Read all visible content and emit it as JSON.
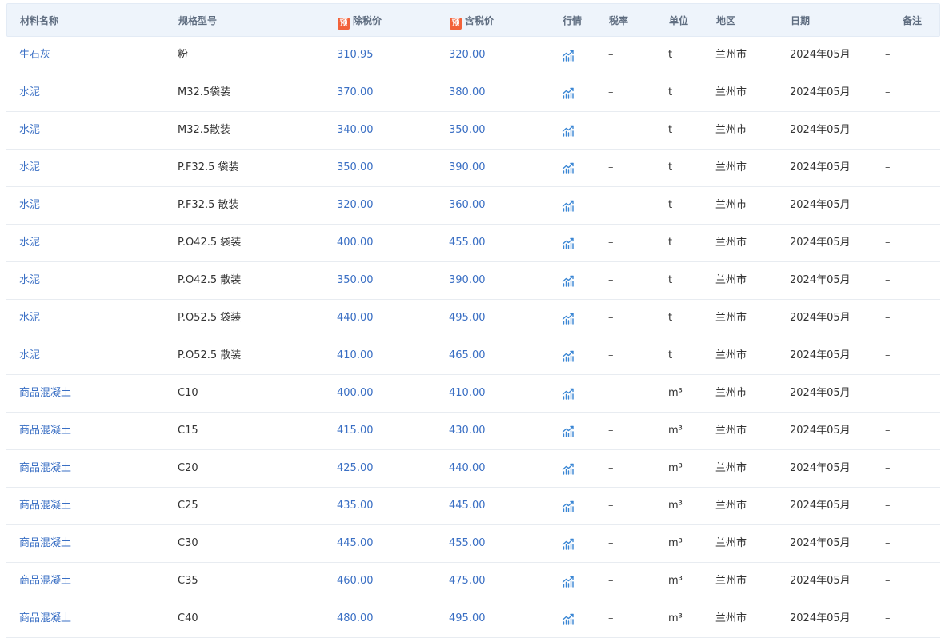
{
  "header": {
    "name": "材料名称",
    "spec": "规格型号",
    "yu_badge": "预",
    "price_ex_tax": "除税价",
    "price_in_tax": "含税价",
    "trend": "行情",
    "tax_rate": "税率",
    "unit": "单位",
    "region": "地区",
    "date": "日期",
    "note": "备注"
  },
  "icons": {
    "trend": "trend-chart-icon"
  },
  "colors": {
    "link": "#3a6fc4",
    "badge": "#f2623a",
    "header_bg": "#eef4fb"
  },
  "rows": [
    {
      "name": "生石灰",
      "spec": "粉",
      "ex": "310.95",
      "inc": "320.00",
      "tax": "–",
      "unit": "t",
      "region": "兰州市",
      "date": "2024年05月",
      "note": "–"
    },
    {
      "name": "水泥",
      "spec": "M32.5袋装",
      "ex": "370.00",
      "inc": "380.00",
      "tax": "–",
      "unit": "t",
      "region": "兰州市",
      "date": "2024年05月",
      "note": "–"
    },
    {
      "name": "水泥",
      "spec": "M32.5散装",
      "ex": "340.00",
      "inc": "350.00",
      "tax": "–",
      "unit": "t",
      "region": "兰州市",
      "date": "2024年05月",
      "note": "–"
    },
    {
      "name": "水泥",
      "spec": "P.F32.5 袋装",
      "ex": "350.00",
      "inc": "390.00",
      "tax": "–",
      "unit": "t",
      "region": "兰州市",
      "date": "2024年05月",
      "note": "–"
    },
    {
      "name": "水泥",
      "spec": "P.F32.5 散装",
      "ex": "320.00",
      "inc": "360.00",
      "tax": "–",
      "unit": "t",
      "region": "兰州市",
      "date": "2024年05月",
      "note": "–"
    },
    {
      "name": "水泥",
      "spec": "P.O42.5 袋装",
      "ex": "400.00",
      "inc": "455.00",
      "tax": "–",
      "unit": "t",
      "region": "兰州市",
      "date": "2024年05月",
      "note": "–"
    },
    {
      "name": "水泥",
      "spec": "P.O42.5 散装",
      "ex": "350.00",
      "inc": "390.00",
      "tax": "–",
      "unit": "t",
      "region": "兰州市",
      "date": "2024年05月",
      "note": "–"
    },
    {
      "name": "水泥",
      "spec": "P.O52.5 袋装",
      "ex": "440.00",
      "inc": "495.00",
      "tax": "–",
      "unit": "t",
      "region": "兰州市",
      "date": "2024年05月",
      "note": "–"
    },
    {
      "name": "水泥",
      "spec": "P.O52.5 散装",
      "ex": "410.00",
      "inc": "465.00",
      "tax": "–",
      "unit": "t",
      "region": "兰州市",
      "date": "2024年05月",
      "note": "–"
    },
    {
      "name": "商品混凝土",
      "spec": "C10",
      "ex": "400.00",
      "inc": "410.00",
      "tax": "–",
      "unit": "m³",
      "region": "兰州市",
      "date": "2024年05月",
      "note": "–"
    },
    {
      "name": "商品混凝土",
      "spec": "C15",
      "ex": "415.00",
      "inc": "430.00",
      "tax": "–",
      "unit": "m³",
      "region": "兰州市",
      "date": "2024年05月",
      "note": "–"
    },
    {
      "name": "商品混凝土",
      "spec": "C20",
      "ex": "425.00",
      "inc": "440.00",
      "tax": "–",
      "unit": "m³",
      "region": "兰州市",
      "date": "2024年05月",
      "note": "–"
    },
    {
      "name": "商品混凝土",
      "spec": "C25",
      "ex": "435.00",
      "inc": "445.00",
      "tax": "–",
      "unit": "m³",
      "region": "兰州市",
      "date": "2024年05月",
      "note": "–"
    },
    {
      "name": "商品混凝土",
      "spec": "C30",
      "ex": "445.00",
      "inc": "455.00",
      "tax": "–",
      "unit": "m³",
      "region": "兰州市",
      "date": "2024年05月",
      "note": "–"
    },
    {
      "name": "商品混凝土",
      "spec": "C35",
      "ex": "460.00",
      "inc": "475.00",
      "tax": "–",
      "unit": "m³",
      "region": "兰州市",
      "date": "2024年05月",
      "note": "–"
    },
    {
      "name": "商品混凝土",
      "spec": "C40",
      "ex": "480.00",
      "inc": "495.00",
      "tax": "–",
      "unit": "m³",
      "region": "兰州市",
      "date": "2024年05月",
      "note": "–"
    }
  ]
}
